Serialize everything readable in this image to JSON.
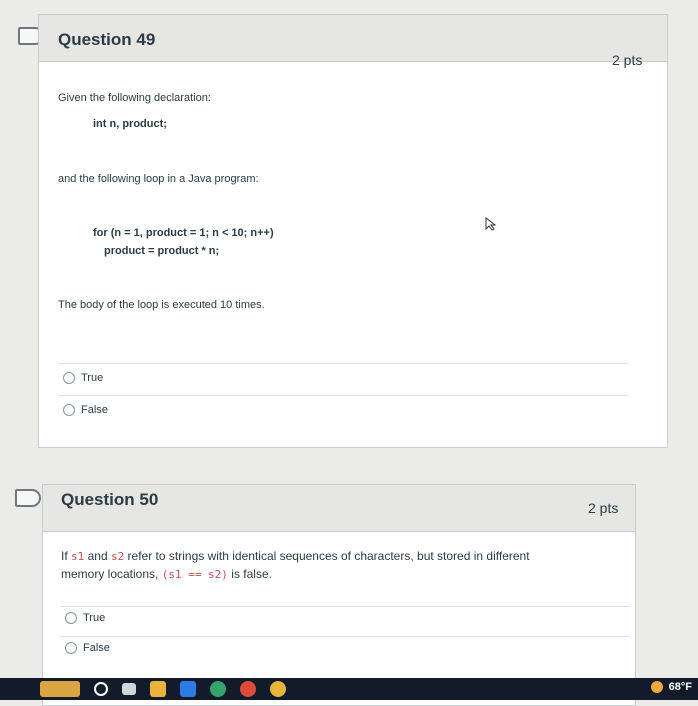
{
  "q49": {
    "title": "Question 49",
    "points": "2 pts",
    "line1": "Given the following declaration:",
    "decl": "int n, product;",
    "line2": "and the following loop in a Java program:",
    "loop1": "for (n = 1, product = 1; n < 10; n++)",
    "loop2": "product = product * n;",
    "statement": "The body of the loop is executed 10 times.",
    "options": [
      "True",
      "False"
    ]
  },
  "q50": {
    "title": "Question 50",
    "points": "2 pts",
    "t1": "If ",
    "s1": "s1",
    "t2": " and ",
    "s2": "s2",
    "t3": " refer to strings with identical sequences of characters, but stored in different",
    "t4": "memory locations, ",
    "expr": "(s1 == s2)",
    "t5": " is false.",
    "options": [
      "True",
      "False"
    ]
  },
  "taskbar": {
    "weather": "68°F"
  }
}
